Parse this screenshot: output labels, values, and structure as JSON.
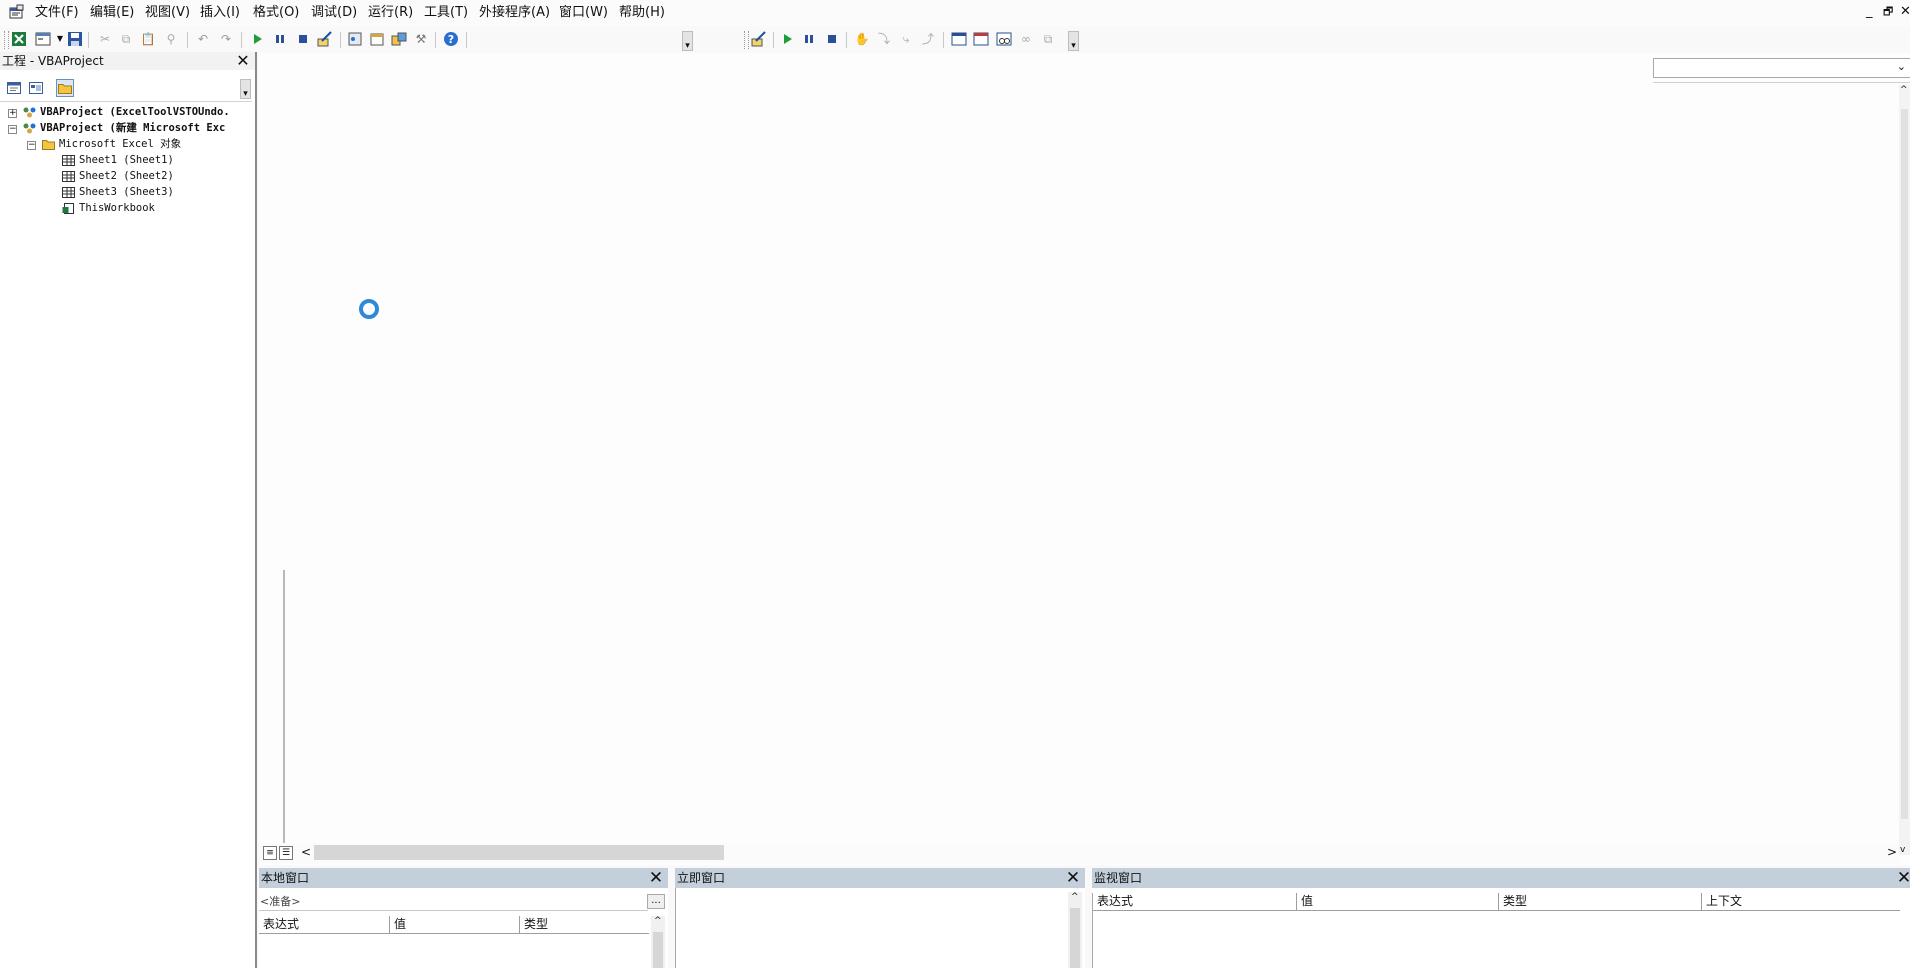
{
  "menubar": {
    "items": [
      "文件(F)",
      "编辑(E)",
      "视图(V)",
      "插入(I)",
      "格式(O)",
      "调试(D)",
      "运行(R)",
      "工具(T)",
      "外接程序(A)",
      "窗口(W)",
      "帮助(H)"
    ],
    "window_controls": [
      "_",
      "🗗",
      "✕"
    ]
  },
  "project_panel": {
    "title": "工程 - VBAProject",
    "tree": [
      {
        "label": "VBAProject (ExcelToolVSTOUndo.",
        "bold": true
      },
      {
        "label": "VBAProject (新建 Microsoft Exc",
        "bold": true
      },
      {
        "label": "Microsoft Excel 对象",
        "bold": false
      },
      {
        "label": "Sheet1 (Sheet1)",
        "bold": false
      },
      {
        "label": "Sheet2 (Sheet2)",
        "bold": false
      },
      {
        "label": "Sheet3 (Sheet3)",
        "bold": false
      },
      {
        "label": "ThisWorkbook",
        "bold": false
      }
    ]
  },
  "locals_window": {
    "title": "本地窗口",
    "context": "<准备>",
    "browse_button": "...",
    "columns": [
      "表达式",
      "值",
      "类型"
    ]
  },
  "immediate_window": {
    "title": "立即窗口"
  },
  "watch_window": {
    "title": "监视窗口",
    "columns": [
      "表达式",
      "值",
      "类型",
      "上下文"
    ]
  },
  "colors": {
    "pane_title_bg": "#c3cfdb",
    "loading_ring": "#2e8ad8",
    "run_green": "#1e9e3a",
    "stop_blue": "#2b4f9b",
    "help_blue": "#2a6fd0"
  }
}
